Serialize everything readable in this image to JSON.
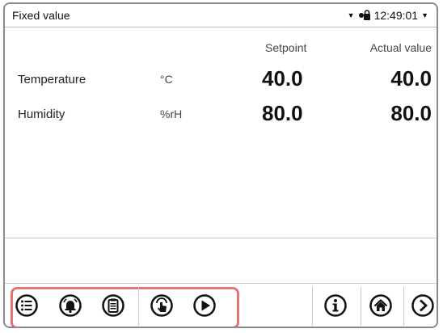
{
  "header": {
    "title": "Fixed value",
    "time": "12:49:01"
  },
  "columns": {
    "setpoint": "Setpoint",
    "actual": "Actual value"
  },
  "rows": [
    {
      "name": "Temperature",
      "unit": "°C",
      "setpoint": "40.0",
      "actual": "40.0"
    },
    {
      "name": "Humidity",
      "unit": "%rH",
      "setpoint": "80.0",
      "actual": "80.0"
    }
  ],
  "toolbar": {
    "left_buttons": [
      "menu-list-icon",
      "alarm-bell-icon",
      "clipboard-icon",
      "touch-hand-icon",
      "play-icon"
    ],
    "right_buttons": [
      "info-icon",
      "home-icon",
      "arrow-right-icon"
    ]
  },
  "colors": {
    "highlight": "#e37575",
    "icon": "#111111"
  }
}
